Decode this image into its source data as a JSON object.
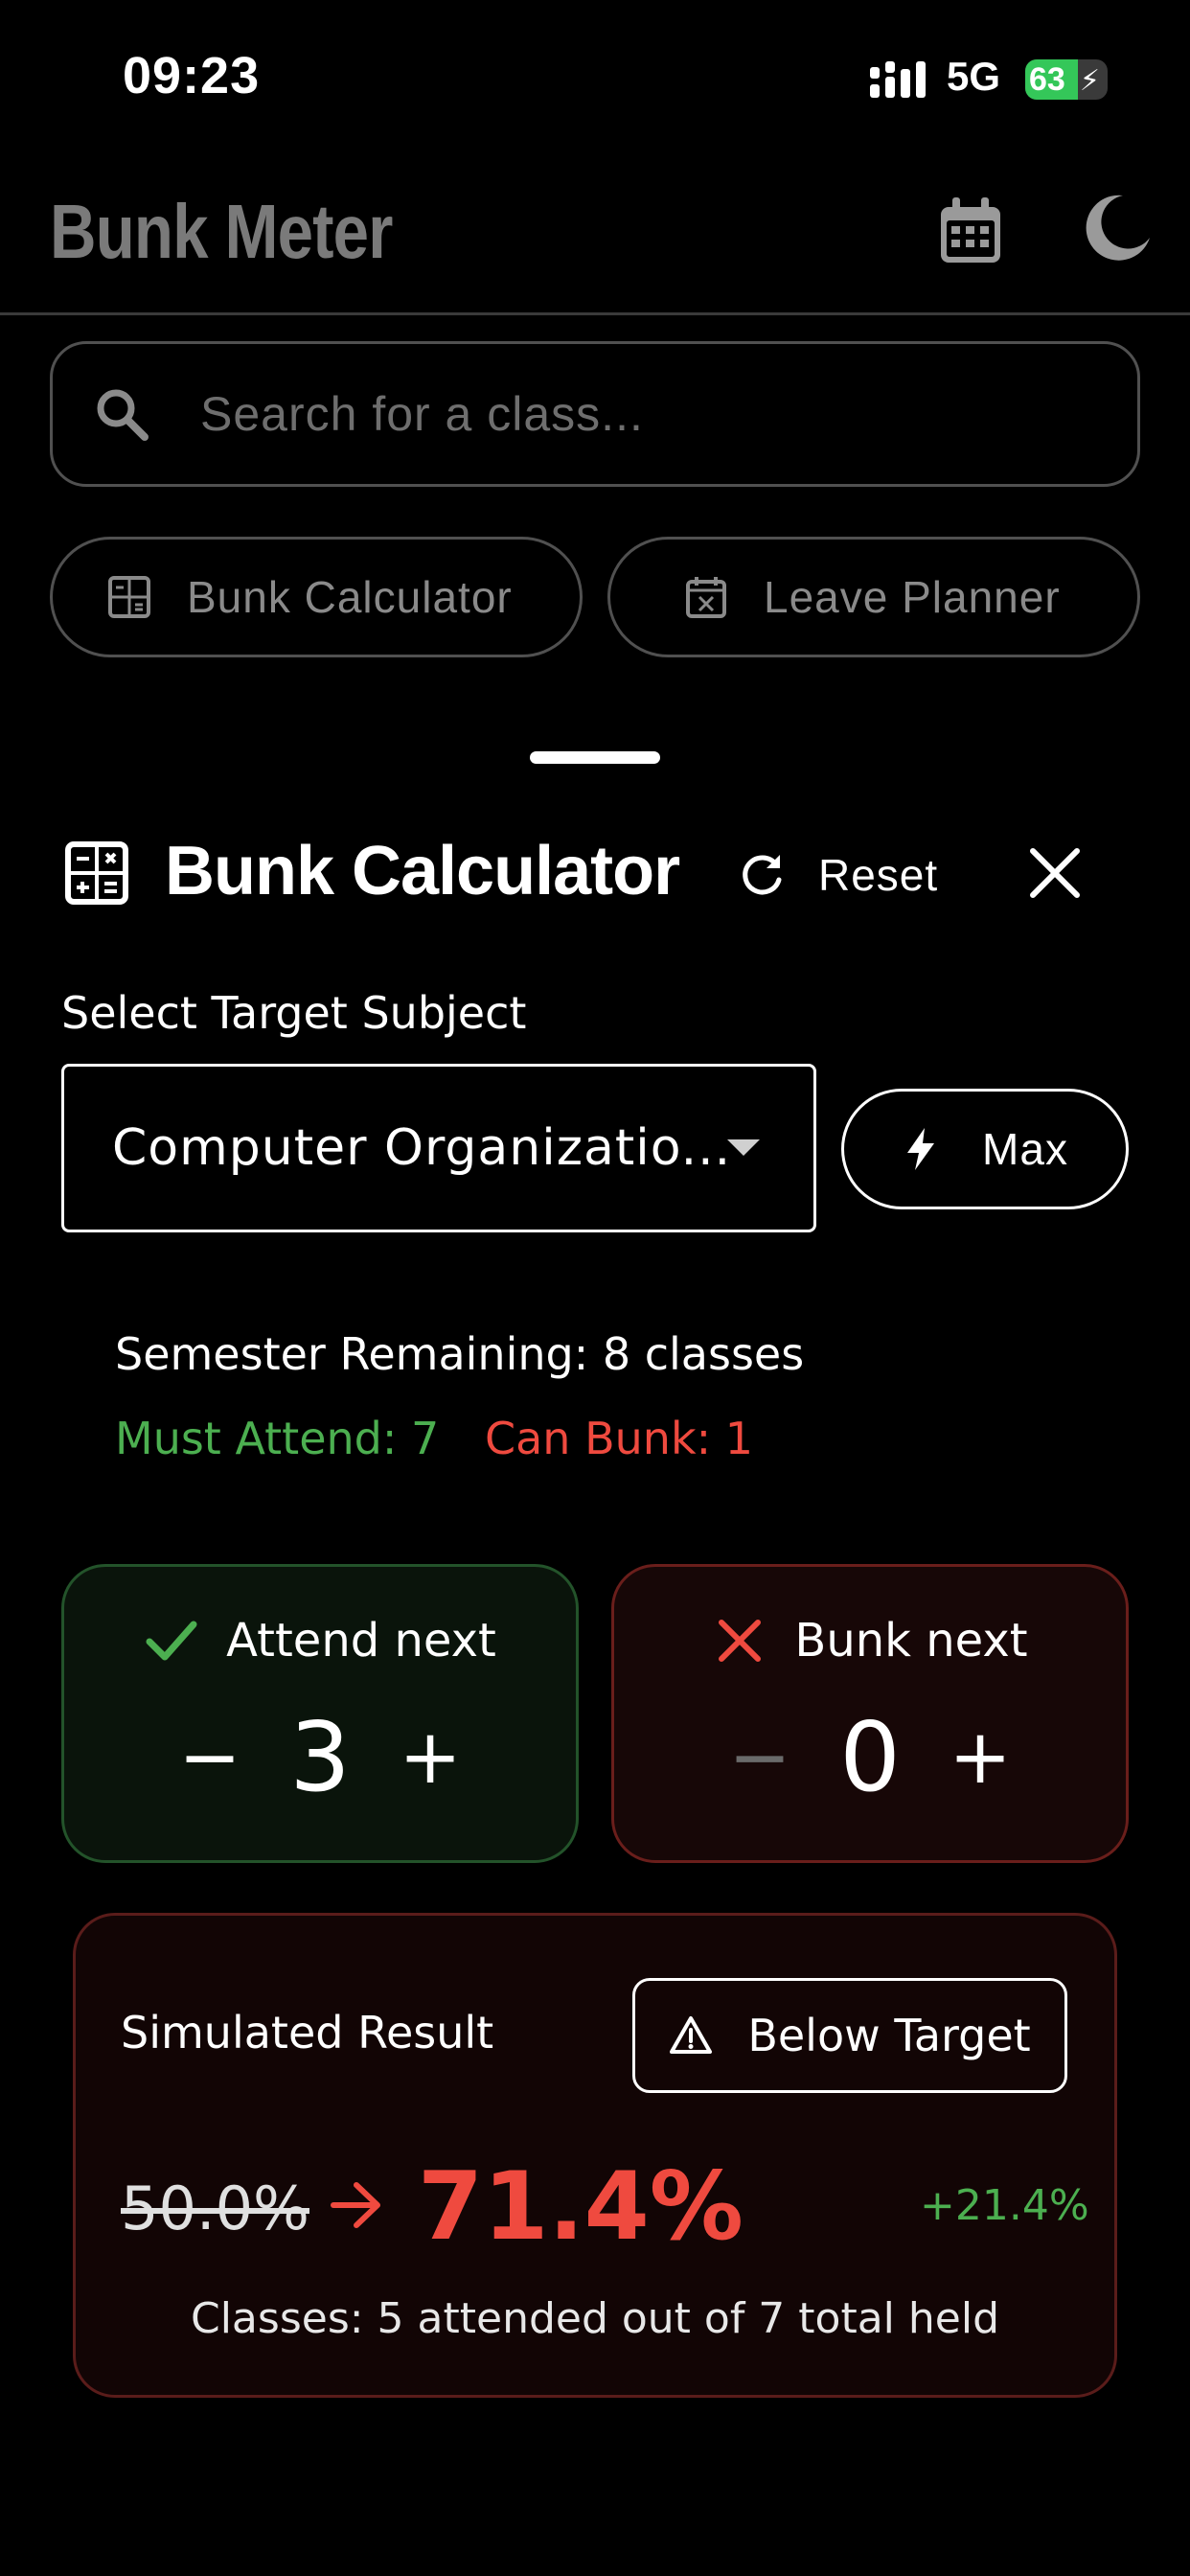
{
  "status_bar": {
    "time": "09:23",
    "network": "5G",
    "battery": "63"
  },
  "app_bar": {
    "title": "Bunk Meter",
    "icons": [
      "calendar-icon",
      "moon-icon"
    ]
  },
  "search": {
    "placeholder": "Search for a class..."
  },
  "chips": {
    "bunk_calculator": "Bunk Calculator",
    "leave_planner": "Leave Planner"
  },
  "calculator": {
    "title": "Bunk Calculator",
    "reset_label": "Reset",
    "select_label": "Select Target Subject",
    "selected_subject": "Computer Organizatio...",
    "max_label": "Max",
    "semester_remaining": "Semester Remaining: 8 classes",
    "must_attend": "Must Attend: 7",
    "can_bunk": "Can Bunk: 1",
    "attend": {
      "label": "Attend next",
      "value": "3",
      "minus": "−",
      "plus": "+"
    },
    "bunk": {
      "label": "Bunk next",
      "value": "0",
      "minus": "−",
      "plus": "+"
    },
    "result": {
      "label": "Simulated Result",
      "badge": "Below Target",
      "old_pct": "50.0%",
      "new_pct": "71.4%",
      "delta": "+21.4%",
      "classes_line": "Classes: 5 attended out of 7 total held"
    }
  },
  "colors": {
    "background": "#000000",
    "green": "#4caf50",
    "red": "#ef4a3f",
    "border": "#505050"
  }
}
